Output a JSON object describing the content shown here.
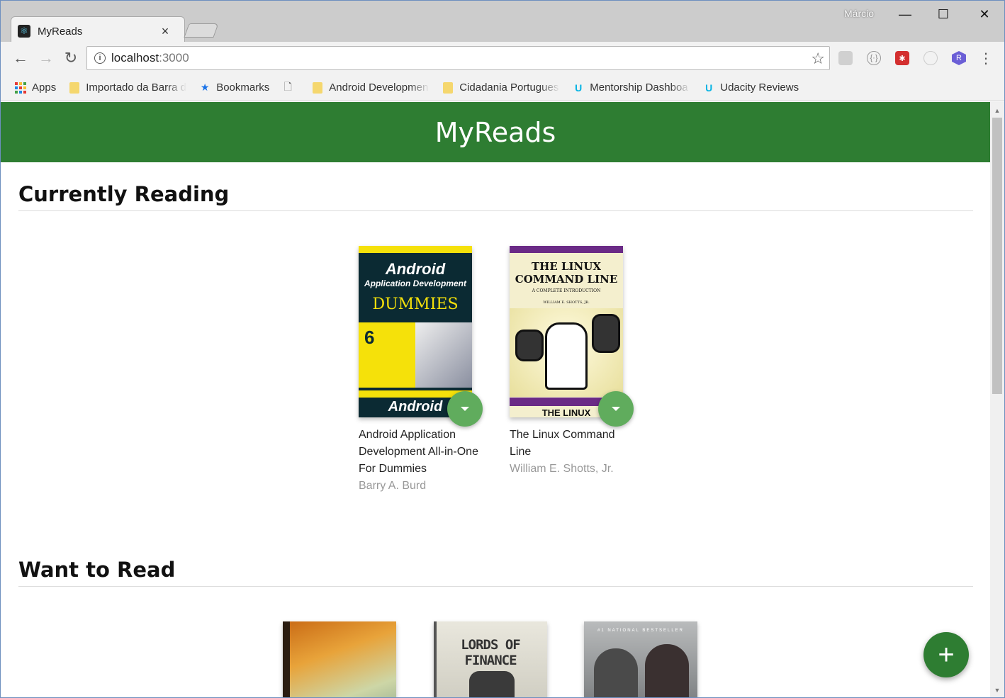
{
  "browser": {
    "tab_title": "MyReads",
    "tab_close": "×",
    "user_name": "Márcio",
    "url_host": "localhost",
    "url_port": ":3000",
    "window_controls": {
      "minimize": "—",
      "maximize": "☐",
      "close": "✕"
    }
  },
  "bookmarks": [
    {
      "label": "Apps",
      "icon": "apps-grid-icon"
    },
    {
      "label": "Importado da Barra d",
      "icon": "folder-icon"
    },
    {
      "label": "Bookmarks",
      "icon": "star-icon"
    },
    {
      "label": "",
      "icon": "page-icon"
    },
    {
      "label": "Android Developmen",
      "icon": "folder-icon"
    },
    {
      "label": "Cidadania Portugues",
      "icon": "folder-icon"
    },
    {
      "label": "Mentorship Dashboa",
      "icon": "udacity-icon"
    },
    {
      "label": "Udacity Reviews",
      "icon": "udacity-icon"
    }
  ],
  "app": {
    "title": "MyReads",
    "add_button": "+",
    "header_color": "#2e7d32"
  },
  "shelves": [
    {
      "title": "Currently Reading",
      "books": [
        {
          "title": "Android Application Development All-in-One For Dummies",
          "author": "Barry A. Burd",
          "cover_text": "Android",
          "cover_sub": "Application Development",
          "cover_brand": "DUMMIES"
        },
        {
          "title": "The Linux Command Line",
          "author": "William E. Shotts, Jr.",
          "cover_text": "THE LINUX COMMAND LINE",
          "cover_sub": "A COMPLETE INTRODUCTION",
          "cover_brand": "WILLIAM E. SHOTTS, JR."
        }
      ]
    },
    {
      "title": "Want to Read",
      "books": [
        {
          "cover_text": "",
          "cover_sub": ""
        },
        {
          "cover_text": "LORDS OF FINANCE",
          "cover_sub": ""
        },
        {
          "cover_text": "#1 NATIONAL BESTSELLER",
          "cover_sub": ""
        }
      ]
    }
  ]
}
